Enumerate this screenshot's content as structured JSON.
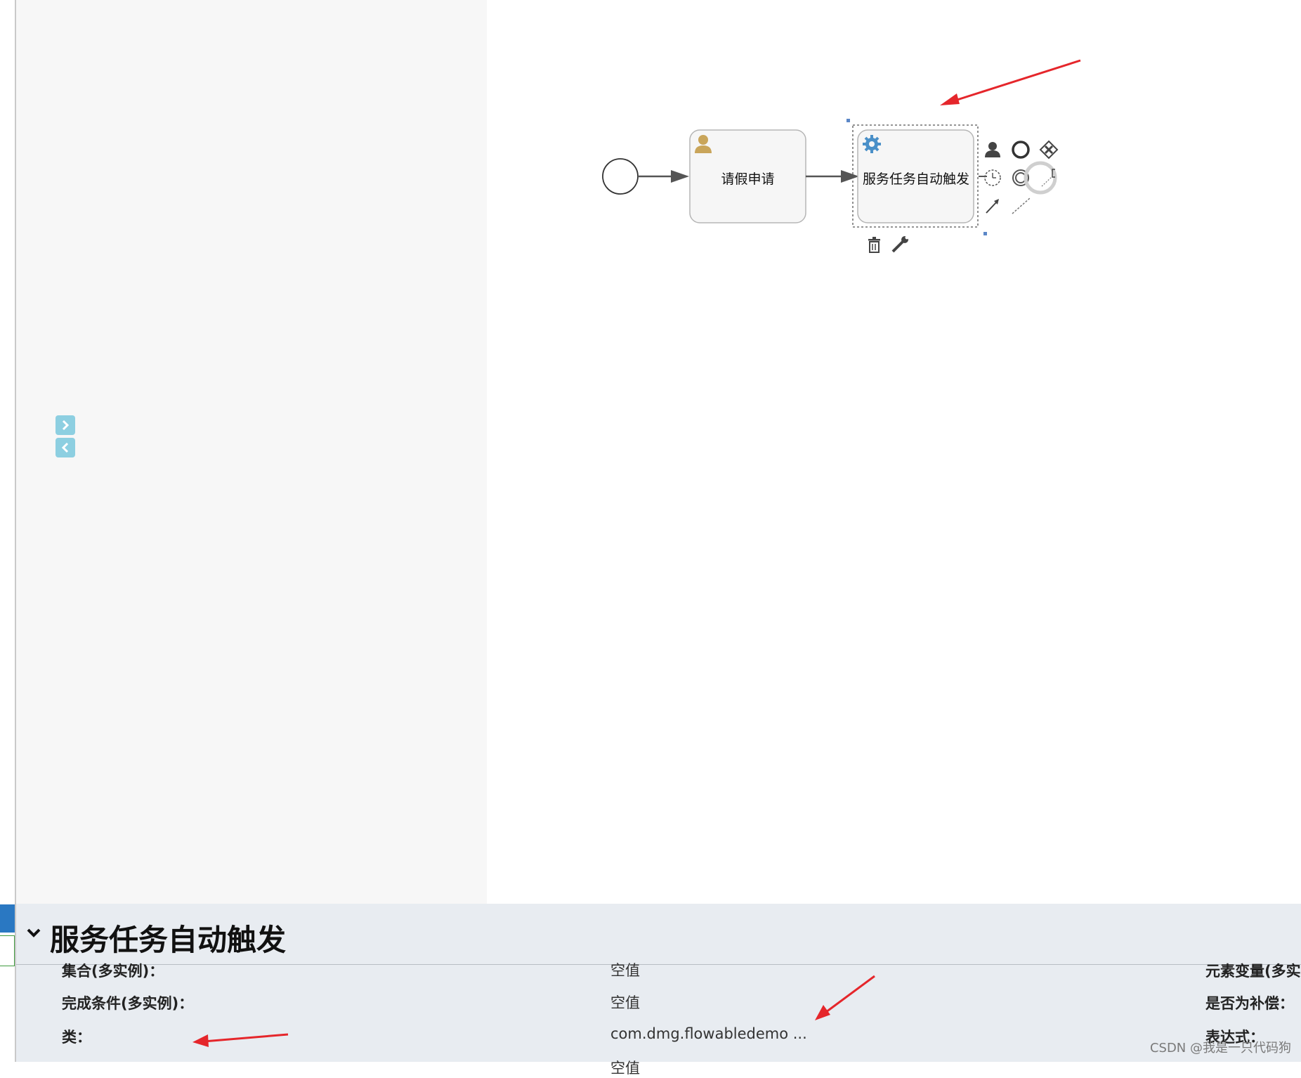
{
  "canvas": {
    "tasks": [
      {
        "label": "请假申请",
        "icon": "user-icon"
      },
      {
        "label": "服务任务自动触发",
        "icon": "gear-icon"
      }
    ],
    "palette_tools": [
      "user-task-icon",
      "end-event-icon",
      "gateway-icon",
      "intermediate-event-icon",
      "boundary-event-icon",
      "annotation-icon",
      "connect-arrow-icon",
      "association-icon"
    ],
    "element_actions": [
      "trash-icon",
      "wrench-icon"
    ]
  },
  "properties": {
    "title": "服务任务自动触发",
    "rows": [
      {
        "label": "集合(多实例)：",
        "value": "空值"
      },
      {
        "label": "完成条件(多实例)：",
        "value": "空值"
      },
      {
        "label": "类：",
        "value": "com.dmg.flowabledemo ..."
      },
      {
        "label": "",
        "value": "空值"
      }
    ],
    "right_labels": [
      "元素变量(多实",
      "是否为补偿：",
      "表达式："
    ]
  },
  "watermark": "CSDN @我是一只代码狗",
  "colors": {
    "annotation_arrow": "#e5262b",
    "panel_bg": "#e8ecf1",
    "toggle_btn": "#8dcfe1",
    "gear": "#4a90c8",
    "user": "#c9a55a"
  }
}
